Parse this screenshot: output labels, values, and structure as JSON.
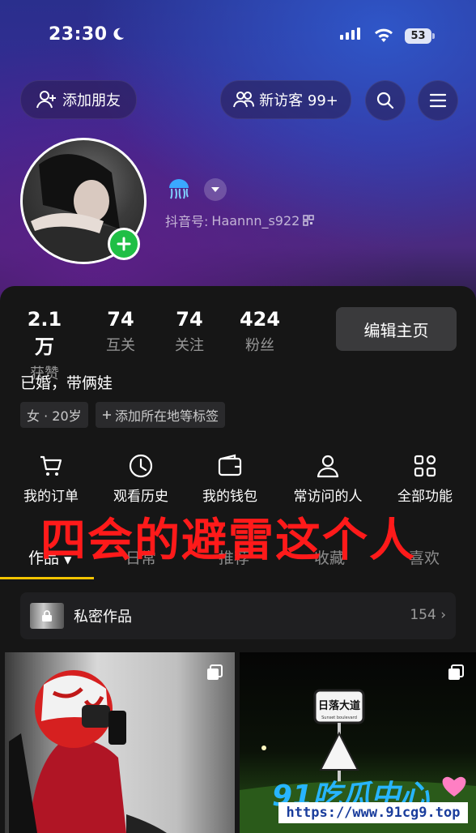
{
  "status_bar": {
    "time": "23:30",
    "battery": "53"
  },
  "header": {
    "add_friend_label": "添加朋友",
    "visitors_label": "新访客 99+"
  },
  "profile": {
    "douyin_id_prefix": "抖音号:",
    "douyin_id": "Haannn_s922"
  },
  "stats": [
    {
      "value": "2.1万",
      "label": "获赞"
    },
    {
      "value": "74",
      "label": "互关"
    },
    {
      "value": "74",
      "label": "关注"
    },
    {
      "value": "424",
      "label": "粉丝"
    }
  ],
  "edit_profile_label": "编辑主页",
  "bio": "已婚，带俩娃",
  "tags": [
    "女 · 20岁",
    "添加所在地等标签"
  ],
  "functions": [
    {
      "label": "我的订单",
      "icon": "cart-icon"
    },
    {
      "label": "观看历史",
      "icon": "clock-icon"
    },
    {
      "label": "我的钱包",
      "icon": "wallet-icon"
    },
    {
      "label": "常访问的人",
      "icon": "person-icon"
    },
    {
      "label": "全部功能",
      "icon": "grid-icon"
    }
  ],
  "overlay_caption": "四会的避雷这个人",
  "tabs": [
    "作品",
    "日常",
    "推荐",
    "收藏",
    "喜欢"
  ],
  "active_tab": "作品",
  "private_works": {
    "label": "私密作品",
    "count": "154"
  },
  "thumbnail_texts": {
    "sign_title": "日落大道",
    "sign_subtitle": "Sunset boulevard"
  },
  "watermark": {
    "logo": "91吃瓜中心",
    "url": "https://www.91cg9.top"
  },
  "colors": {
    "accent_yellow": "#f4c400",
    "plus_green": "#1fbf45",
    "overlay_red": "#ff1a1a",
    "watermark_blue": "#27b5ff"
  }
}
